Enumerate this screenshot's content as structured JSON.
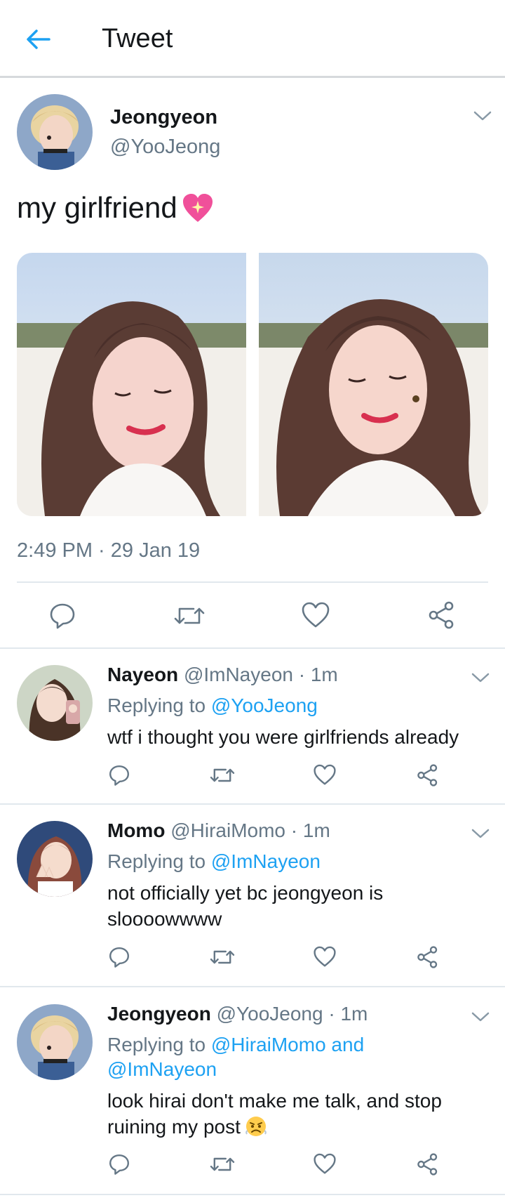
{
  "header": {
    "title": "Tweet"
  },
  "main_tweet": {
    "name": "Jeongyeon",
    "handle": "@YooJeong",
    "text": "my girlfriend",
    "timestamp": "2:49 PM · 29 Jan 19"
  },
  "replies": [
    {
      "name": "Nayeon",
      "meta": "@ImNayeon · 1m",
      "replying_prefix": "Replying to",
      "replying_to": "@YooJeong",
      "body": "wtf i thought you were girlfriends already"
    },
    {
      "name": "Momo",
      "meta": "@HiraiMomo · 1m",
      "replying_prefix": "Replying to",
      "replying_to": "@ImNayeon",
      "body": "not officially yet bc jeongyeon is sloooowwww"
    },
    {
      "name": "Jeongyeon",
      "meta": "@YooJeong · 1m",
      "replying_prefix": "Replying to",
      "replying_to": "@HiraiMomo and",
      "replying_to_line2": "@ImNayeon",
      "body": "look hirai don't make me talk, and stop ruining my post"
    }
  ],
  "icons": [
    "back-arrow-icon",
    "chevron-down-icon",
    "reply-icon",
    "retweet-icon",
    "like-icon",
    "share-icon",
    "sparkling-heart-emoji",
    "angry-face-emoji"
  ],
  "colors": {
    "accent": "#1da1f2",
    "secondary_text": "#657786",
    "divider": "#e1e8ed"
  }
}
